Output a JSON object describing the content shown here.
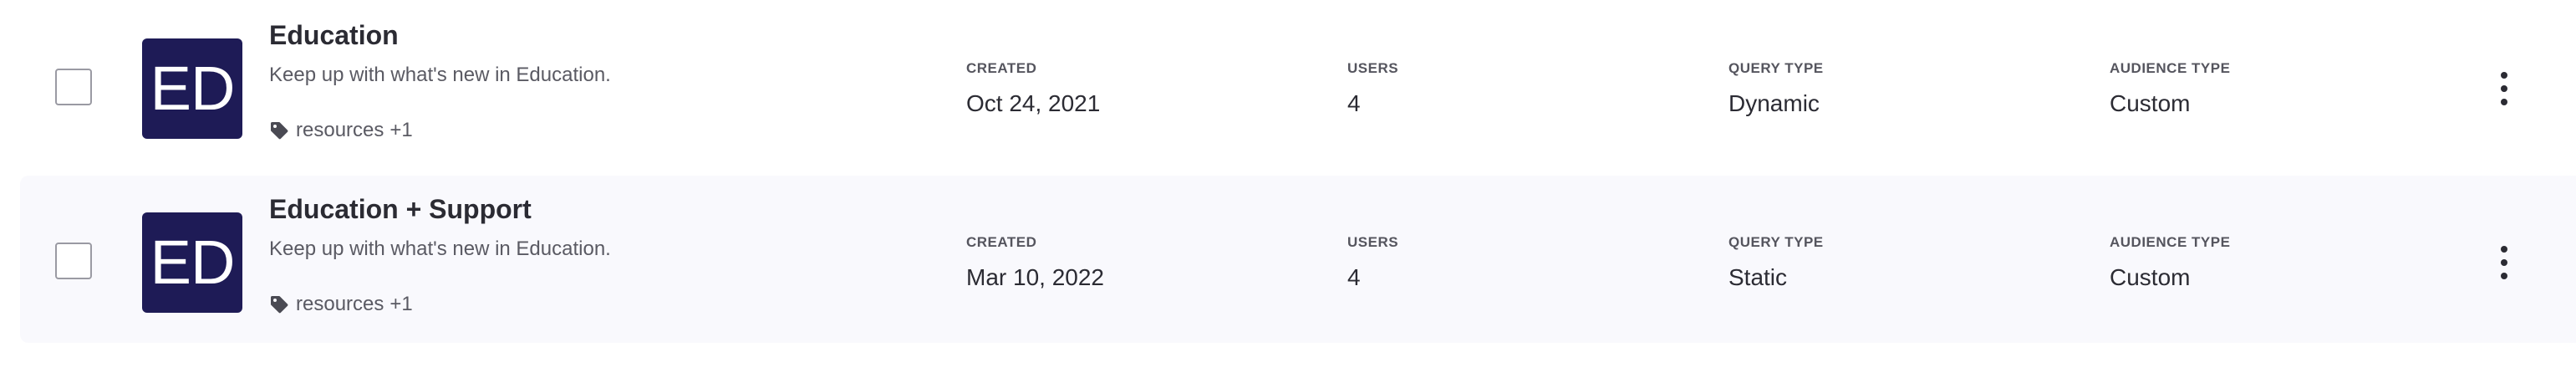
{
  "audiences": [
    {
      "name": "Education",
      "description": "Keep up with what's new in Education.",
      "avatar_initials": "ED",
      "tag": "resources",
      "tag_more": "+1",
      "created_label": "CREATED",
      "created": "Oct 24, 2021",
      "users_label": "USERS",
      "users": "4",
      "query_type_label": "QUERY TYPE",
      "query_type": "Dynamic",
      "audience_type_label": "AUDIENCE TYPE",
      "audience_type": "Custom"
    },
    {
      "name": "Education + Support",
      "description": "Keep up with what's new in Education.",
      "avatar_initials": "ED",
      "tag": "resources",
      "tag_more": "+1",
      "created_label": "CREATED",
      "created": "Mar 10, 2022",
      "users_label": "USERS",
      "users": "4",
      "query_type_label": "QUERY TYPE",
      "query_type": "Static",
      "audience_type_label": "AUDIENCE TYPE",
      "audience_type": "Custom"
    }
  ],
  "colors": {
    "avatar_bg": "#1e1b56",
    "row_alt_bg": "#f9f9fd",
    "text_primary": "#2b2b33",
    "text_secondary": "#5a5a63"
  },
  "icons": {
    "tag": "tag-icon",
    "menu": "more-vertical-icon"
  }
}
